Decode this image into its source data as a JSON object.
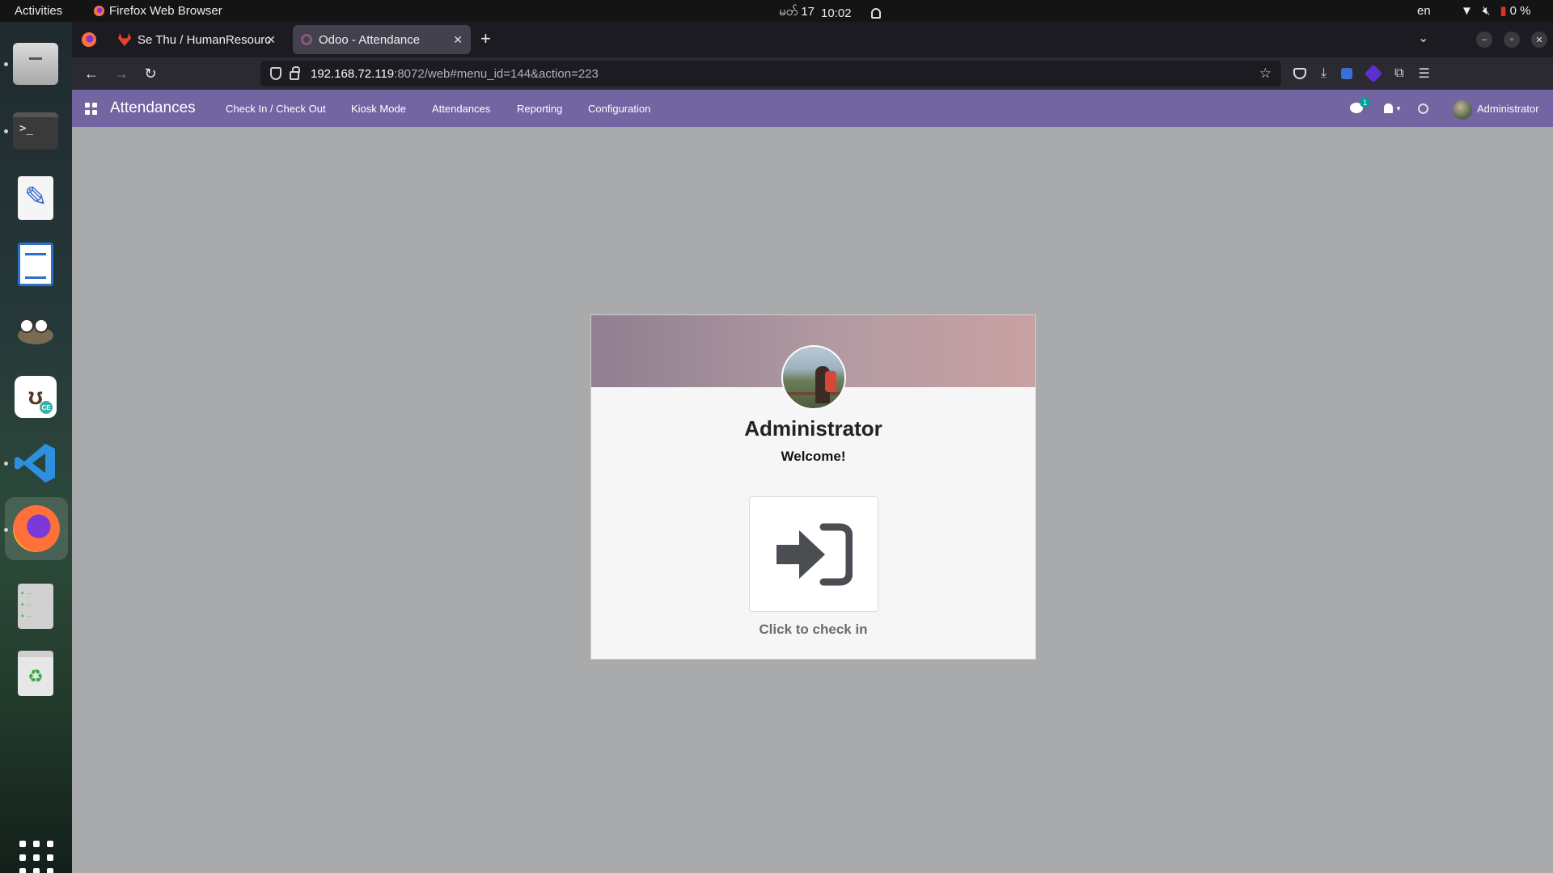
{
  "topbar": {
    "activities": "Activities",
    "app_name": "Firefox Web Browser",
    "clock_day": "မတ် 17",
    "clock_time": "10:02",
    "language": "en",
    "battery": "0 %"
  },
  "dock": {
    "items": [
      "files-icon",
      "terminal-icon",
      "text-editor-icon",
      "writer-icon",
      "gimp-icon",
      "dbeaver-icon",
      "vscode-icon",
      "firefox-icon",
      "server-icon",
      "trash-icon",
      "show-apps-icon"
    ]
  },
  "browser": {
    "tabs": [
      {
        "title": "Se Thu / HumanResource",
        "icon": "gitlab-icon"
      },
      {
        "title": "Odoo - Attendance",
        "icon": "odoo-icon"
      }
    ],
    "url_host": "192.168.72.119",
    "url_path": ":8072/web#menu_id=144&action=223"
  },
  "odoo": {
    "brand": "Attendances",
    "menu": [
      "Check In / Check Out",
      "Kiosk Mode",
      "Attendances",
      "Reporting",
      "Configuration"
    ],
    "chat_badge": "1",
    "user": "Administrator"
  },
  "checkin_card": {
    "employee_name": "Administrator",
    "greeting": "Welcome!",
    "button_label": "Click to check in"
  },
  "colors": {
    "odoo_nav": "#7364a2",
    "content_bg": "#a9aaac",
    "banner_start": "#8f7f90",
    "banner_end": "#caa1a3"
  }
}
